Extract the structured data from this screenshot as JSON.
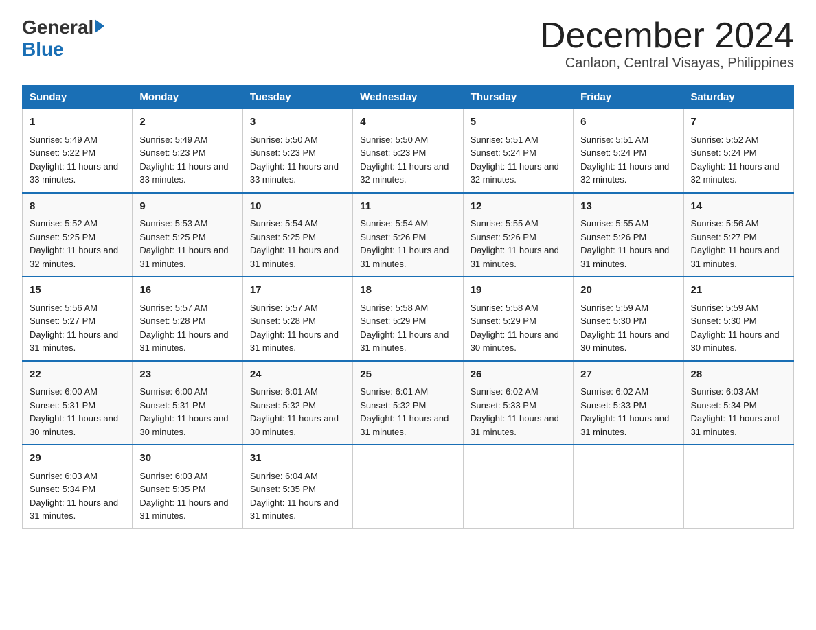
{
  "header": {
    "logo_general": "General",
    "logo_blue": "Blue",
    "month_title": "December 2024",
    "location": "Canlaon, Central Visayas, Philippines"
  },
  "days_of_week": [
    "Sunday",
    "Monday",
    "Tuesday",
    "Wednesday",
    "Thursday",
    "Friday",
    "Saturday"
  ],
  "weeks": [
    [
      {
        "day": 1,
        "sunrise": "5:49 AM",
        "sunset": "5:22 PM",
        "daylight": "11 hours and 33 minutes."
      },
      {
        "day": 2,
        "sunrise": "5:49 AM",
        "sunset": "5:23 PM",
        "daylight": "11 hours and 33 minutes."
      },
      {
        "day": 3,
        "sunrise": "5:50 AM",
        "sunset": "5:23 PM",
        "daylight": "11 hours and 33 minutes."
      },
      {
        "day": 4,
        "sunrise": "5:50 AM",
        "sunset": "5:23 PM",
        "daylight": "11 hours and 32 minutes."
      },
      {
        "day": 5,
        "sunrise": "5:51 AM",
        "sunset": "5:24 PM",
        "daylight": "11 hours and 32 minutes."
      },
      {
        "day": 6,
        "sunrise": "5:51 AM",
        "sunset": "5:24 PM",
        "daylight": "11 hours and 32 minutes."
      },
      {
        "day": 7,
        "sunrise": "5:52 AM",
        "sunset": "5:24 PM",
        "daylight": "11 hours and 32 minutes."
      }
    ],
    [
      {
        "day": 8,
        "sunrise": "5:52 AM",
        "sunset": "5:25 PM",
        "daylight": "11 hours and 32 minutes."
      },
      {
        "day": 9,
        "sunrise": "5:53 AM",
        "sunset": "5:25 PM",
        "daylight": "11 hours and 31 minutes."
      },
      {
        "day": 10,
        "sunrise": "5:54 AM",
        "sunset": "5:25 PM",
        "daylight": "11 hours and 31 minutes."
      },
      {
        "day": 11,
        "sunrise": "5:54 AM",
        "sunset": "5:26 PM",
        "daylight": "11 hours and 31 minutes."
      },
      {
        "day": 12,
        "sunrise": "5:55 AM",
        "sunset": "5:26 PM",
        "daylight": "11 hours and 31 minutes."
      },
      {
        "day": 13,
        "sunrise": "5:55 AM",
        "sunset": "5:26 PM",
        "daylight": "11 hours and 31 minutes."
      },
      {
        "day": 14,
        "sunrise": "5:56 AM",
        "sunset": "5:27 PM",
        "daylight": "11 hours and 31 minutes."
      }
    ],
    [
      {
        "day": 15,
        "sunrise": "5:56 AM",
        "sunset": "5:27 PM",
        "daylight": "11 hours and 31 minutes."
      },
      {
        "day": 16,
        "sunrise": "5:57 AM",
        "sunset": "5:28 PM",
        "daylight": "11 hours and 31 minutes."
      },
      {
        "day": 17,
        "sunrise": "5:57 AM",
        "sunset": "5:28 PM",
        "daylight": "11 hours and 31 minutes."
      },
      {
        "day": 18,
        "sunrise": "5:58 AM",
        "sunset": "5:29 PM",
        "daylight": "11 hours and 31 minutes."
      },
      {
        "day": 19,
        "sunrise": "5:58 AM",
        "sunset": "5:29 PM",
        "daylight": "11 hours and 30 minutes."
      },
      {
        "day": 20,
        "sunrise": "5:59 AM",
        "sunset": "5:30 PM",
        "daylight": "11 hours and 30 minutes."
      },
      {
        "day": 21,
        "sunrise": "5:59 AM",
        "sunset": "5:30 PM",
        "daylight": "11 hours and 30 minutes."
      }
    ],
    [
      {
        "day": 22,
        "sunrise": "6:00 AM",
        "sunset": "5:31 PM",
        "daylight": "11 hours and 30 minutes."
      },
      {
        "day": 23,
        "sunrise": "6:00 AM",
        "sunset": "5:31 PM",
        "daylight": "11 hours and 30 minutes."
      },
      {
        "day": 24,
        "sunrise": "6:01 AM",
        "sunset": "5:32 PM",
        "daylight": "11 hours and 30 minutes."
      },
      {
        "day": 25,
        "sunrise": "6:01 AM",
        "sunset": "5:32 PM",
        "daylight": "11 hours and 31 minutes."
      },
      {
        "day": 26,
        "sunrise": "6:02 AM",
        "sunset": "5:33 PM",
        "daylight": "11 hours and 31 minutes."
      },
      {
        "day": 27,
        "sunrise": "6:02 AM",
        "sunset": "5:33 PM",
        "daylight": "11 hours and 31 minutes."
      },
      {
        "day": 28,
        "sunrise": "6:03 AM",
        "sunset": "5:34 PM",
        "daylight": "11 hours and 31 minutes."
      }
    ],
    [
      {
        "day": 29,
        "sunrise": "6:03 AM",
        "sunset": "5:34 PM",
        "daylight": "11 hours and 31 minutes."
      },
      {
        "day": 30,
        "sunrise": "6:03 AM",
        "sunset": "5:35 PM",
        "daylight": "11 hours and 31 minutes."
      },
      {
        "day": 31,
        "sunrise": "6:04 AM",
        "sunset": "5:35 PM",
        "daylight": "11 hours and 31 minutes."
      },
      null,
      null,
      null,
      null
    ]
  ]
}
